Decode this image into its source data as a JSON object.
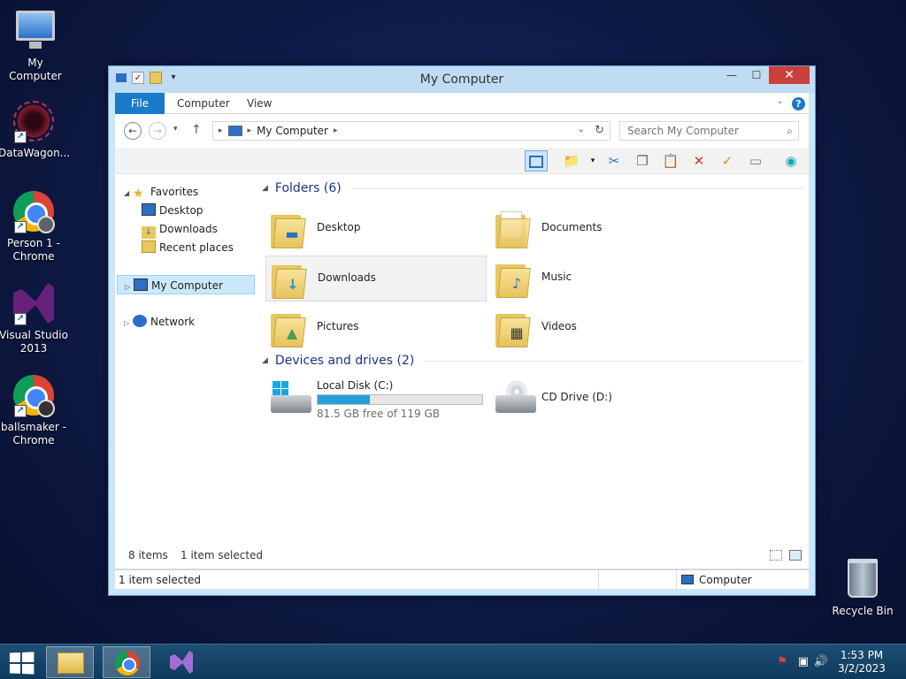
{
  "desktop": {
    "icons": [
      {
        "label": "My Computer",
        "icon": "computer-icon"
      },
      {
        "label": "DataWagon...",
        "icon": "datawagon-icon"
      },
      {
        "label": "Person 1 - Chrome",
        "icon": "chrome-icon"
      },
      {
        "label": "Visual Studio 2013",
        "icon": "visual-studio-icon"
      },
      {
        "label": "ballsmaker - Chrome",
        "icon": "chrome-icon"
      },
      {
        "label": "Recycle Bin",
        "icon": "recycle-bin-icon"
      }
    ]
  },
  "window": {
    "title": "My Computer",
    "ribbon_tabs": [
      "File",
      "Computer",
      "View"
    ],
    "help_label": "?",
    "address": {
      "crumb": "My Computer"
    },
    "search": {
      "placeholder": "Search My Computer"
    },
    "nav": {
      "favorites": "Favorites",
      "favorites_items": [
        "Desktop",
        "Downloads",
        "Recent places"
      ],
      "this_pc": "My Computer",
      "network": "Network"
    },
    "folders": {
      "header": "Folders (6)",
      "items": [
        {
          "name": "Desktop",
          "icon": "desktop-folder-icon"
        },
        {
          "name": "Documents",
          "icon": "documents-folder-icon"
        },
        {
          "name": "Downloads",
          "icon": "downloads-folder-icon"
        },
        {
          "name": "Music",
          "icon": "music-folder-icon"
        },
        {
          "name": "Pictures",
          "icon": "pictures-folder-icon"
        },
        {
          "name": "Videos",
          "icon": "videos-folder-icon"
        }
      ]
    },
    "drives": {
      "header": "Devices and drives (2)",
      "items": [
        {
          "name": "Local Disk (C:)",
          "free_text": "81.5 GB free of 119 GB",
          "used_fraction": 0.315
        },
        {
          "name": "CD Drive (D:)"
        }
      ]
    },
    "item_bar": {
      "count": "8 items",
      "selected": "1 item selected"
    },
    "status_bar": {
      "selected": "1 item selected",
      "location": "Computer"
    }
  },
  "taskbar": {
    "clock_time": "1:53 PM",
    "clock_date": "3/2/2023"
  },
  "colors": {
    "accent": "#1979ca",
    "drive_fill": "#26a0da",
    "close_button": "#c7403a"
  }
}
